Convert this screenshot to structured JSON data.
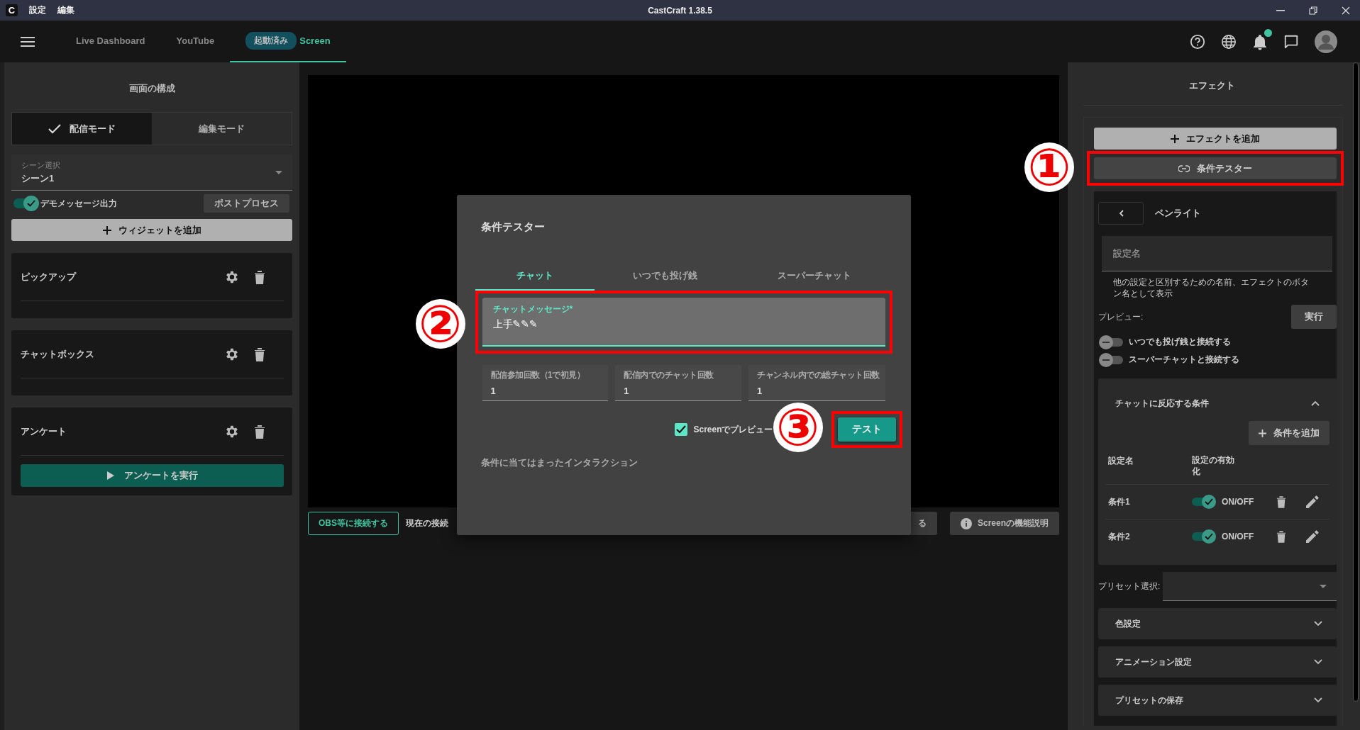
{
  "window": {
    "app_letter": "C",
    "menu": [
      "設定",
      "編集"
    ],
    "title": "CastCraft 1.38.5"
  },
  "nav": {
    "tabs": [
      {
        "label": "Live Dashboard",
        "selected": false
      },
      {
        "label": "YouTube",
        "selected": false
      },
      {
        "label": "Screen",
        "badge": "起動済み",
        "selected": true
      }
    ],
    "notification_dot": true
  },
  "left_panel": {
    "title": "画面の構成",
    "modes": [
      {
        "label": "配信モード",
        "selected": true
      },
      {
        "label": "編集モード",
        "selected": false
      }
    ],
    "scene": {
      "label": "シーン選択",
      "value": "シーン1"
    },
    "demo_toggle": {
      "label": "デモメッセージ出力",
      "on": true
    },
    "postprocess_button": "ポストプロセス",
    "add_widget_button": "ウィジェットを追加",
    "widgets": [
      {
        "name": "ピックアップ"
      },
      {
        "name": "チャットボックス"
      },
      {
        "name": "アンケート",
        "action": "アンケートを実行"
      }
    ]
  },
  "bottom_bar": {
    "connect_button": "OBS等に接続する",
    "connection_text": "現在の接続",
    "covered_button": "る",
    "help_button": "Screenの機能説明"
  },
  "dialog": {
    "title": "条件テスター",
    "tabs": [
      {
        "label": "チャット",
        "selected": true
      },
      {
        "label": "いつでも投げ銭",
        "selected": false
      },
      {
        "label": "スーパーチャット",
        "selected": false
      }
    ],
    "message_field": {
      "label": "チャットメッセージ*",
      "value": "上手✎✎✎",
      "highlighted": true,
      "callout": "②"
    },
    "count_fields": [
      {
        "label": "配信参加回数（1で初見）",
        "value": "1"
      },
      {
        "label": "配信内でのチャット回数",
        "value": "1"
      },
      {
        "label": "チャンネル内での総チャット回数",
        "value": "1"
      }
    ],
    "preview_checkbox": {
      "label": "Screenでプレビュー",
      "checked": true
    },
    "test_button": {
      "label": "テスト",
      "highlighted": true,
      "callout": "③"
    },
    "result_heading": "条件に当てはまったインタラクション"
  },
  "right_panel": {
    "title": "エフェクト",
    "add_effect_button": "エフェクトを追加",
    "tester_button": {
      "label": "条件テスター",
      "highlighted": true,
      "callout": "①"
    },
    "effect": {
      "name": "ペンライト",
      "name_field": {
        "placeholder": "設定名"
      },
      "hint": "他の設定と区別するための名前、エフェクトのボタン名として表示",
      "preview_label": "プレビュー:",
      "run_button": "実行",
      "toggles": [
        {
          "label": "いつでも投げ銭と接続する",
          "on": false
        },
        {
          "label": "スーパーチャットと接続する",
          "on": false
        }
      ],
      "conditions": {
        "title": "チャットに反応する条件",
        "expanded": true,
        "add_button": "条件を追加",
        "columns": [
          "設定名",
          "設定の有効化"
        ],
        "rows": [
          {
            "name": "条件1",
            "on": true,
            "toggle_label": "ON/OFF"
          },
          {
            "name": "条件2",
            "on": true,
            "toggle_label": "ON/OFF"
          }
        ]
      },
      "preset_label": "プリセット選択:",
      "sections": [
        {
          "title": "色設定",
          "expanded": false
        },
        {
          "title": "アニメーション設定",
          "expanded": false
        },
        {
          "title": "プリセットの保存",
          "expanded": false
        }
      ]
    }
  }
}
